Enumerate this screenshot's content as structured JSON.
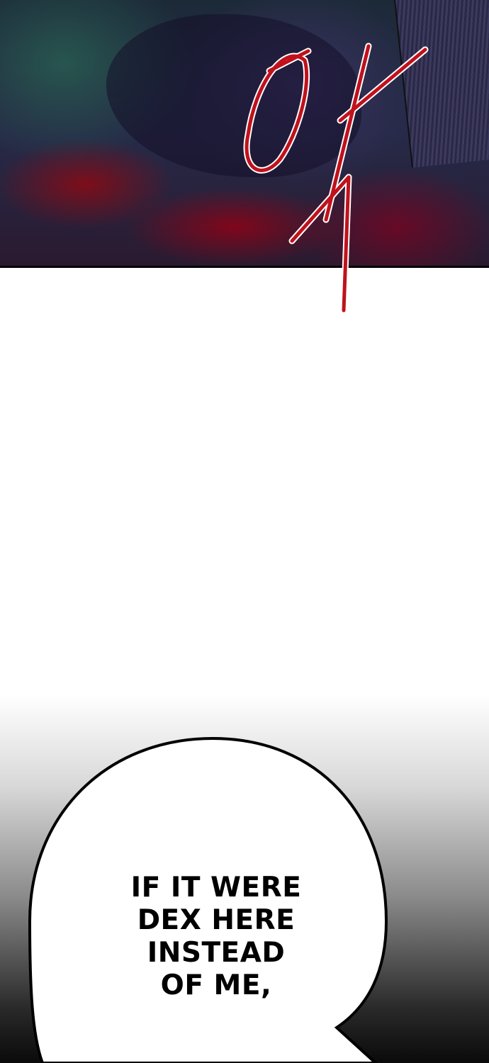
{
  "sfx": {
    "text": "아"
  },
  "dialogue": {
    "lines": [
      "IF IT WERE",
      "DEX HERE INSTEAD",
      "OF ME,"
    ]
  },
  "colors": {
    "sfx_red": "#c0111c",
    "bubble_fill": "#ffffff",
    "bubble_outline": "#000000"
  }
}
